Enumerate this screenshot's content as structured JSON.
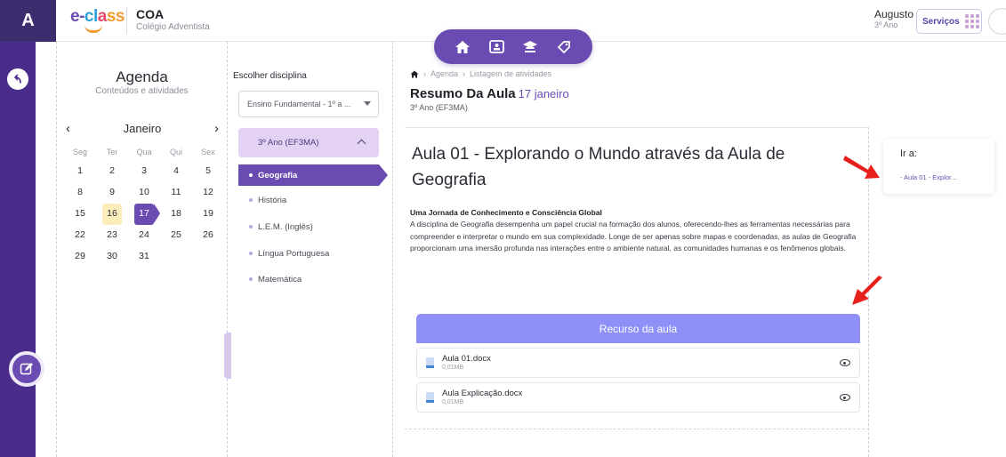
{
  "header": {
    "brand_initial": "A",
    "logo_text": "e-class",
    "school_code": "COA",
    "school_name": "Colégio Adventista",
    "user_name": "Augusto",
    "user_grade": "3º Ano",
    "services_label": "Serviços"
  },
  "nav_icons": [
    "home-icon",
    "id-card-icon",
    "graduation-cap-icon",
    "tag-icon"
  ],
  "agenda": {
    "title": "Agenda",
    "subtitle": "Conteúdos e atividades",
    "month": "Janeiro",
    "weekdays": [
      "Seg",
      "Ter",
      "Qua",
      "Qui",
      "Sex"
    ],
    "weeks": [
      [
        "1",
        "2",
        "3",
        "4",
        "5"
      ],
      [
        "8",
        "9",
        "10",
        "11",
        "12"
      ],
      [
        "15",
        "16",
        "17",
        "18",
        "19"
      ],
      [
        "22",
        "23",
        "24",
        "25",
        "26"
      ],
      [
        "29",
        "30",
        "31",
        "",
        ""
      ]
    ],
    "today": "16",
    "selected": "17"
  },
  "disciplines": {
    "label": "Escolher disciplina",
    "level_select": "Ensino Fundamental - 1º a ...",
    "class_name": "3º Ano (EF3MA)",
    "active_subject": "Geografia",
    "subjects": [
      "História",
      "L.E.M. (Inglês)",
      "Língua Portuguesa",
      "Matemática"
    ]
  },
  "breadcrumb": {
    "items": [
      "Agenda",
      "Listagem de atividades"
    ]
  },
  "page": {
    "title": "Resumo Da Aula",
    "date": "17 janeiro",
    "class": "3º Ano (EF3MA)"
  },
  "lesson": {
    "title": "Aula 01 - Explorando o Mundo através da Aula de Geografia",
    "subtitle": "Uma Jornada de Conhecimento e Consciência Global",
    "body": "A disciplina de Geografia desempenha um papel crucial na formação dos alunos, oferecendo-lhes as ferramentas necessárias para compreender e interpretar o mundo em sua complexidade. Longe de ser apenas sobre mapas e coordenadas, as aulas de Geografia proporcionam uma imersão profunda nas interações entre o ambiente natural, as comunidades humanas e os fenômenos globais.",
    "resources_title": "Recurso da aula",
    "files": [
      {
        "name": "Aula 01.docx",
        "size": "0,01MB"
      },
      {
        "name": "Aula Explicação.docx",
        "size": "0,01MB"
      }
    ]
  },
  "goto": {
    "title": "Ir a:",
    "link": "Aula 01 - Explor..."
  },
  "colors": {
    "primary": "#6a4bb2",
    "rail": "#4a2d8a",
    "resource_header": "#8e8ff7",
    "today_highlight": "#fbeebc",
    "annotation_red": "#e8201c"
  }
}
